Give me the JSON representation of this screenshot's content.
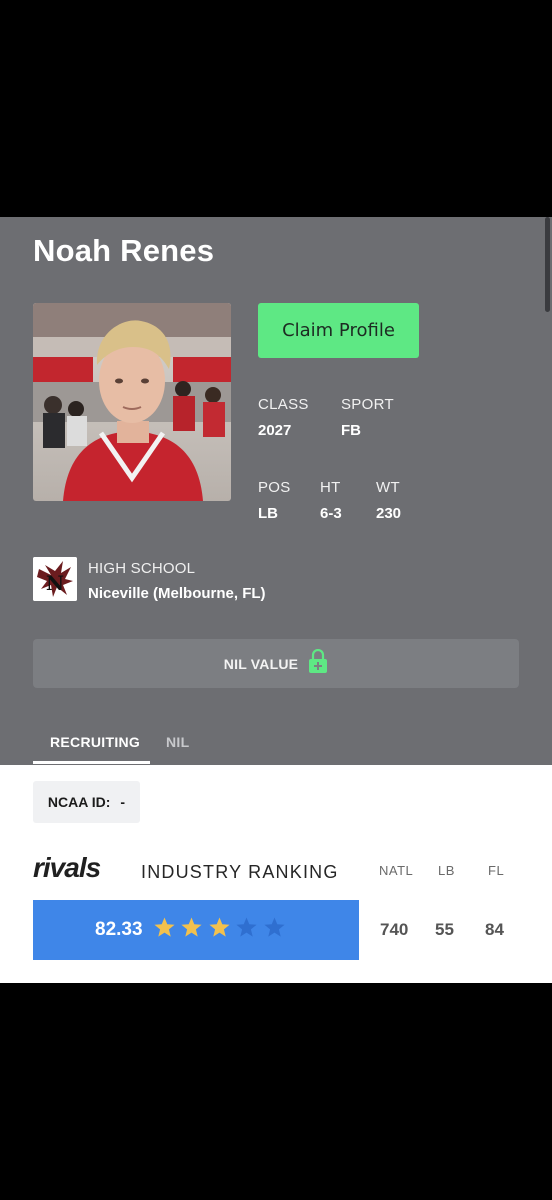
{
  "player": {
    "name": "Noah Renes",
    "claim_label": "Claim Profile",
    "class_label": "CLASS",
    "class_value": "2027",
    "sport_label": "SPORT",
    "sport_value": "FB",
    "pos_label": "POS",
    "pos_value": "LB",
    "ht_label": "HT",
    "ht_value": "6-3",
    "wt_label": "WT",
    "wt_value": "230"
  },
  "school": {
    "label": "HIGH SCHOOL",
    "name": "Niceville (Melbourne, FL)"
  },
  "nil": {
    "label": "NIL VALUE",
    "icon": "lock-plus-icon"
  },
  "tabs": [
    {
      "label": "RECRUITING",
      "active": true
    },
    {
      "label": "NIL",
      "active": false
    }
  ],
  "ncaa": {
    "label": "NCAA ID:",
    "value": "-"
  },
  "ranking": {
    "brand": "rivals",
    "title": "INDUSTRY RANKING",
    "rating": "82.33",
    "stars_filled": 3,
    "stars_total": 5,
    "columns": [
      {
        "head": "NATL",
        "value": "740"
      },
      {
        "head": "LB",
        "value": "55"
      },
      {
        "head": "FL",
        "value": "84"
      }
    ]
  },
  "colors": {
    "card_bg": "#6d6e72",
    "claim_green": "#5ee884",
    "rating_blue": "#3f86e8",
    "star_gold": "#f2c14e",
    "star_empty": "#2f6fd0"
  }
}
